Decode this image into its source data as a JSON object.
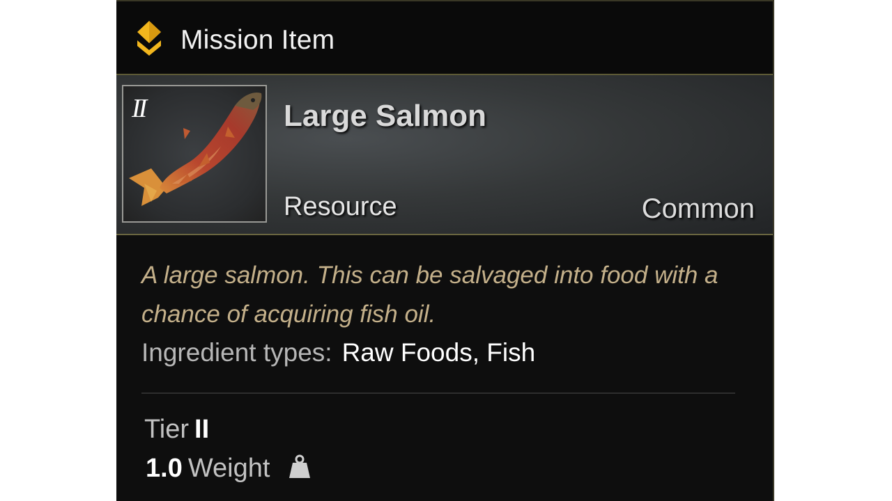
{
  "header": {
    "label": "Mission Item",
    "icon": "mission-chevron-icon",
    "accent": "#f2b61d"
  },
  "item": {
    "tier_roman": "II",
    "name": "Large Salmon",
    "category": "Resource",
    "rarity": "Common",
    "image_icon": "large-salmon-icon"
  },
  "description": "A large salmon. This can be salvaged into food with a chance of acquiring fish oil.",
  "ingredients": {
    "label": "Ingredient types:",
    "value": "Raw Foods, Fish"
  },
  "stats": {
    "tier_label": "Tier",
    "tier_value": "II",
    "weight_value": "1.0",
    "weight_label": "Weight",
    "weight_icon": "weight-icon"
  }
}
